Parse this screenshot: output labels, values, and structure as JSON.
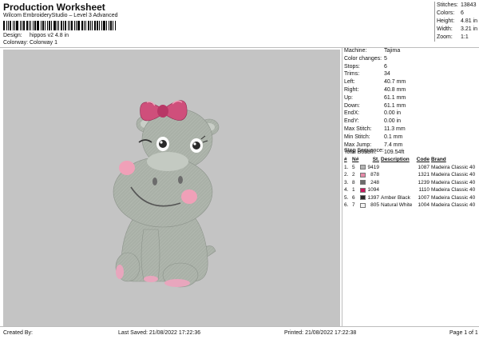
{
  "header": {
    "title": "Production Worksheet",
    "subtitle": "Wilcom EmbroideryStudio – Level 3 Advanced",
    "design_label": "Design:",
    "design_value": "hippos v2 4.8 in",
    "colorway_label": "Colorway:",
    "colorway_value": "Colorway 1"
  },
  "stats": [
    {
      "label": "Stitches:",
      "value": "13843"
    },
    {
      "label": "Colors:",
      "value": "6"
    },
    {
      "label": "Height:",
      "value": "4.81 in"
    },
    {
      "label": "Width:",
      "value": "3.21 in"
    },
    {
      "label": "Zoom:",
      "value": "1:1"
    }
  ],
  "machine": [
    {
      "label": "Machine:",
      "value": "Tajima"
    },
    {
      "label": "Color changes:",
      "value": "5"
    },
    {
      "label": "Stops:",
      "value": "6"
    },
    {
      "label": "Trims:",
      "value": "34"
    },
    {
      "label": "Left:",
      "value": "40.7 mm"
    },
    {
      "label": "Right:",
      "value": "40.8 mm"
    },
    {
      "label": "Up:",
      "value": "61.1 mm"
    },
    {
      "label": "Down:",
      "value": "61.1 mm"
    },
    {
      "label": "EndX:",
      "value": "0.00 in"
    },
    {
      "label": "EndY:",
      "value": "0.00 in"
    },
    {
      "label": "Max Stitch:",
      "value": "11.3 mm"
    },
    {
      "label": "Min Stitch:",
      "value": "0.1 mm"
    },
    {
      "label": "Max Jump:",
      "value": "7.4 mm"
    },
    {
      "label": "Total Bobbin:",
      "value": "109.54ft"
    }
  ],
  "stop_sequence": {
    "title": "Stop Sequence:",
    "headers": [
      "#",
      "N#",
      "St.",
      "Description",
      "Code",
      "Brand"
    ],
    "rows": [
      {
        "num": "1.",
        "n": "5",
        "color": "#b4b4b4",
        "st": "9419",
        "desc": "",
        "code": "1087",
        "brand": "Madeira Classic 40"
      },
      {
        "num": "2.",
        "n": "2",
        "color": "#e58aa8",
        "st": "878",
        "desc": "",
        "code": "1321",
        "brand": "Madeira Classic 40"
      },
      {
        "num": "3.",
        "n": "8",
        "color": "#6c6c6c",
        "st": "248",
        "desc": "",
        "code": "1239",
        "brand": "Madeira Classic 40"
      },
      {
        "num": "4.",
        "n": "1",
        "color": "#c8185e",
        "st": "1094",
        "desc": "",
        "code": "1110",
        "brand": "Madeira Classic 40"
      },
      {
        "num": "5.",
        "n": "6",
        "color": "#2a2a2a",
        "st": "1397",
        "desc": "Amber Black",
        "code": "1007",
        "brand": "Madeira Classic 40"
      },
      {
        "num": "6.",
        "n": "7",
        "color": "#f4f4f4",
        "st": "805",
        "desc": "Natural White",
        "code": "1004",
        "brand": "Madeira Classic 40"
      }
    ]
  },
  "footer": {
    "created_by": "Created By:",
    "last_saved": "Last Saved: 21/08/2022 17:22:36",
    "printed": "Printed: 21/08/2022 17:22:38",
    "page": "Page 1 of 1"
  },
  "colors": {
    "canvas_bg": "#c4c4c4",
    "hippo_body": "#a9b0a7",
    "bow": "#cf4f7b",
    "cheek": "#f0a0b8"
  }
}
